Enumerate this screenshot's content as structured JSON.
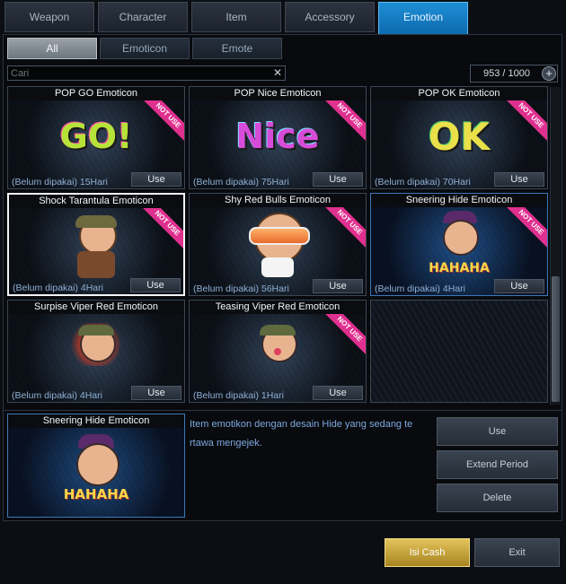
{
  "top_tabs": [
    "Weapon",
    "Character",
    "Item",
    "Accessory",
    "Emotion"
  ],
  "active_top_tab": "Emotion",
  "sub_tabs": [
    "All",
    "Emoticon",
    "Emote"
  ],
  "search": {
    "placeholder": "Cari",
    "clear_icon": "close-icon"
  },
  "inventory_count": "953 / 1000",
  "items": [
    {
      "title": "POP GO Emoticon",
      "status": "(Belum dipakai) 15Hari",
      "use": "Use",
      "ribbon": "NOT USE",
      "art_text": "GO!"
    },
    {
      "title": "POP Nice Emoticon",
      "status": "(Belum dipakai) 75Hari",
      "use": "Use",
      "ribbon": "NOT USE",
      "art_text": "Nice"
    },
    {
      "title": "POP OK Emoticon",
      "status": "(Belum dipakai) 70Hari",
      "use": "Use",
      "ribbon": "NOT USE",
      "art_text": "OK"
    },
    {
      "title": "Shock Tarantula Emoticon",
      "status": "(Belum dipakai) 4Hari",
      "use": "Use",
      "ribbon": "NOT USE"
    },
    {
      "title": "Shy Red Bulls Emoticon",
      "status": "(Belum dipakai) 56Hari",
      "use": "Use",
      "ribbon": "NOT USE"
    },
    {
      "title": "Sneering Hide Emoticon",
      "status": "(Belum dipakai) 4Hari",
      "use": "Use",
      "ribbon": "NOT USE",
      "art_text": "HAHAHA"
    },
    {
      "title": "Surpise Viper Red Emoticon",
      "status": "(Belum dipakai) 4Hari",
      "use": "Use"
    },
    {
      "title": "Teasing Viper Red Emoticon",
      "status": "(Belum dipakai) 1Hari",
      "use": "Use",
      "ribbon": "NOT USE"
    }
  ],
  "detail": {
    "title": "Sneering Hide Emoticon",
    "art_text": "HAHAHA",
    "description_line1": "Item emotikon dengan desain Hide yang sedang te",
    "description_line2": "rtawa mengejek."
  },
  "actions": {
    "use": "Use",
    "extend": "Extend Period",
    "delete": "Delete"
  },
  "footer": {
    "cash": "Isi Cash",
    "exit": "Exit"
  },
  "colors": {
    "accent_tab": "#1a85cf",
    "ribbon": "#e0308f",
    "cash": "#c9a43a"
  }
}
